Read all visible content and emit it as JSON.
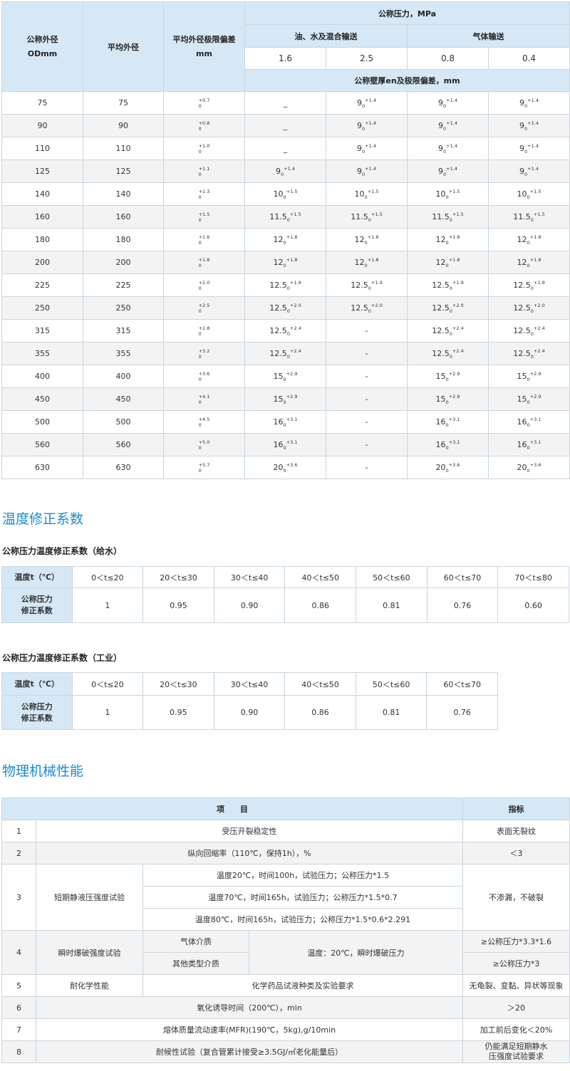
{
  "pipe_table": {
    "headers": {
      "od": "公称外径",
      "od_unit": "ODmm",
      "mean_od": "平均外径",
      "tol": "平均外径极限偏差",
      "tol_unit": "mm",
      "pressure": "公称压力，MPa",
      "oil_water": "油、水及混合输送",
      "gas": "气体输送",
      "p1": "1.6",
      "p2": "2.5",
      "p3": "0.8",
      "p4": "0.4",
      "wall": "公称壁厚en及极限偏差，mm"
    },
    "rows": [
      {
        "od": "75",
        "mean": "75",
        "tol": "+0.7",
        "c1": {
          "v": "_",
          "t": ""
        },
        "c2": {
          "v": "9",
          "t": "+1.4"
        },
        "c3": {
          "v": "9",
          "t": "+1.4"
        },
        "c4": {
          "v": "9",
          "t": "+1.4"
        }
      },
      {
        "od": "90",
        "mean": "90",
        "tol": "+0.8",
        "c1": {
          "v": "_",
          "t": ""
        },
        "c2": {
          "v": "9",
          "t": "+1.4"
        },
        "c3": {
          "v": "9",
          "t": "+1.4"
        },
        "c4": {
          "v": "9",
          "t": "+1.4"
        }
      },
      {
        "od": "110",
        "mean": "110",
        "tol": "+1.0",
        "c1": {
          "v": "_",
          "t": ""
        },
        "c2": {
          "v": "9",
          "t": "+1.4"
        },
        "c3": {
          "v": "9",
          "t": "+1.4"
        },
        "c4": {
          "v": "9",
          "t": "+1.4"
        }
      },
      {
        "od": "125",
        "mean": "125",
        "tol": "+1.1",
        "c1": {
          "v": "9",
          "t": "+1.4"
        },
        "c2": {
          "v": "9",
          "t": "+1.4"
        },
        "c3": {
          "v": "9",
          "t": "+1.4"
        },
        "c4": {
          "v": "9",
          "t": "+1.4"
        }
      },
      {
        "od": "140",
        "mean": "140",
        "tol": "+1.3",
        "c1": {
          "v": "10",
          "t": "+1.5"
        },
        "c2": {
          "v": "10",
          "t": "+1.5"
        },
        "c3": {
          "v": "10",
          "t": "+1.5"
        },
        "c4": {
          "v": "10",
          "t": "+1.5"
        }
      },
      {
        "od": "160",
        "mean": "160",
        "tol": "+1.5",
        "c1": {
          "v": "11.5",
          "t": "+1.5"
        },
        "c2": {
          "v": "11.5",
          "t": "+1.5"
        },
        "c3": {
          "v": "11.5",
          "t": "+1.5"
        },
        "c4": {
          "v": "11.5",
          "t": "+1.5"
        }
      },
      {
        "od": "180",
        "mean": "180",
        "tol": "+1.6",
        "c1": {
          "v": "12",
          "t": "+1.8"
        },
        "c2": {
          "v": "12",
          "t": "+1.8"
        },
        "c3": {
          "v": "12",
          "t": "+1.8"
        },
        "c4": {
          "v": "12",
          "t": "+1.8"
        }
      },
      {
        "od": "200",
        "mean": "200",
        "tol": "+1.8",
        "c1": {
          "v": "12",
          "t": "+1.8"
        },
        "c2": {
          "v": "12",
          "t": "+1.8"
        },
        "c3": {
          "v": "12",
          "t": "+1.8"
        },
        "c4": {
          "v": "12",
          "t": "+1.8"
        }
      },
      {
        "od": "225",
        "mean": "225",
        "tol": "+2.0",
        "c1": {
          "v": "12.5",
          "t": "+1.9"
        },
        "c2": {
          "v": "12.5",
          "t": "+1.9"
        },
        "c3": {
          "v": "12.5",
          "t": "+1.9"
        },
        "c4": {
          "v": "12.5",
          "t": "+1.9"
        }
      },
      {
        "od": "250",
        "mean": "250",
        "tol": "+2.5",
        "c1": {
          "v": "12.5",
          "t": "+2.0"
        },
        "c2": {
          "v": "12.5",
          "t": "+2.0"
        },
        "c3": {
          "v": "12.5",
          "t": "+2.0"
        },
        "c4": {
          "v": "12.5",
          "t": "+2.0"
        }
      },
      {
        "od": "315",
        "mean": "315",
        "tol": "+2.8",
        "c1": {
          "v": "12.5",
          "t": "+2.4"
        },
        "c2": {
          "v": "-",
          "t": ""
        },
        "c3": {
          "v": "12.5",
          "t": "+2.4"
        },
        "c4": {
          "v": "12.5",
          "t": "+2.4"
        }
      },
      {
        "od": "355",
        "mean": "355",
        "tol": "+3.2",
        "c1": {
          "v": "12.5",
          "t": "+2.4"
        },
        "c2": {
          "v": "-",
          "t": ""
        },
        "c3": {
          "v": "12.5",
          "t": "+2.4"
        },
        "c4": {
          "v": "12.5",
          "t": "+2.4"
        }
      },
      {
        "od": "400",
        "mean": "400",
        "tol": "+3.6",
        "c1": {
          "v": "15",
          "t": "+2.9"
        },
        "c2": {
          "v": "-",
          "t": ""
        },
        "c3": {
          "v": "15",
          "t": "+2.9"
        },
        "c4": {
          "v": "15",
          "t": "+2.9"
        }
      },
      {
        "od": "450",
        "mean": "450",
        "tol": "+4.1",
        "c1": {
          "v": "15",
          "t": "+2.9"
        },
        "c2": {
          "v": "-",
          "t": ""
        },
        "c3": {
          "v": "15",
          "t": "+2.9"
        },
        "c4": {
          "v": "15",
          "t": "+2.9"
        }
      },
      {
        "od": "500",
        "mean": "500",
        "tol": "+4.5",
        "c1": {
          "v": "16",
          "t": "+3.1"
        },
        "c2": {
          "v": "-",
          "t": ""
        },
        "c3": {
          "v": "16",
          "t": "+3.1"
        },
        "c4": {
          "v": "16",
          "t": "+3.1"
        }
      },
      {
        "od": "560",
        "mean": "560",
        "tol": "+5.0",
        "c1": {
          "v": "16",
          "t": "+3.1"
        },
        "c2": {
          "v": "-",
          "t": ""
        },
        "c3": {
          "v": "16",
          "t": "+3.1"
        },
        "c4": {
          "v": "16",
          "t": "+3.1"
        }
      },
      {
        "od": "630",
        "mean": "630",
        "tol": "+5.7",
        "c1": {
          "v": "20",
          "t": "+3.6"
        },
        "c2": {
          "v": "-",
          "t": ""
        },
        "c3": {
          "v": "20",
          "t": "+3.6"
        },
        "c4": {
          "v": "20",
          "t": "+3.6"
        }
      }
    ],
    "zero": "0"
  },
  "temp_section": {
    "title": "温度修正系数",
    "water": {
      "subtitle": "公称压力温度修正系数（给水）",
      "row1_label": "温度t（℃）",
      "row2_label_l1": "公称压力",
      "row2_label_l2": "修正系数",
      "ranges": [
        "0＜t≤20",
        "20＜t≤30",
        "30＜t≤40",
        "40＜t≤50",
        "50＜t≤60",
        "60＜t≤70",
        "70＜t≤80"
      ],
      "factors": [
        "1",
        "0.95",
        "0.90",
        "0.86",
        "0.81",
        "0.76",
        "0.60"
      ]
    },
    "industry": {
      "subtitle": "公称压力温度修正系数（工业）",
      "row1_label": "温度t（℃）",
      "row2_label_l1": "公称压力",
      "row2_label_l2": "修正系数",
      "ranges": [
        "0＜t≤20",
        "20＜t≤30",
        "30＜t≤40",
        "40＜t≤50",
        "50＜t≤60",
        "60＜t≤70"
      ],
      "factors": [
        "1",
        "0.95",
        "0.90",
        "0.86",
        "0.81",
        "0.76"
      ]
    }
  },
  "phys_section": {
    "title": "物理机械性能",
    "head_item": "项　　目",
    "head_index": "指标",
    "r1": {
      "no": "1",
      "item": "受压开裂稳定性",
      "index": "表面无裂纹"
    },
    "r2": {
      "no": "2",
      "item": "纵向回缩率（110℃，保持1h），%",
      "index": "＜3"
    },
    "r3": {
      "no": "3",
      "name": "短期静液压强度试验",
      "c1": "温度20℃，时间100h，试验压力；公称压力*1.5",
      "c2": "温度70℃，时间165h，试验压力；公称压力*1.5*0.7",
      "c3": "温度80℃，时间165h，试验压力；公称压力*1.5*0.6*2.291",
      "index": "不渗漏，不破裂"
    },
    "r4": {
      "no": "4",
      "name": "瞬时爆破强度试验",
      "m1": "气体介质",
      "m2": "其他类型介质",
      "cond": "温度：20℃，瞬时爆破压力",
      "i1": "≥公称压力*3.3*1.6",
      "i2": "≥公称压力*3"
    },
    "r5": {
      "no": "5",
      "name": "耐化学性能",
      "item": "化学药品试液种类及实验要求",
      "index": "无龟裂、变黏、异状等现象"
    },
    "r6": {
      "no": "6",
      "item": "氧化诱导时间（200℃），min",
      "index": "＞20"
    },
    "r7": {
      "no": "7",
      "item": "熔体质量流动速率(MFR)(190℃，5kg),g/10min",
      "index": "加工前后变化＜20%"
    },
    "r8": {
      "no": "8",
      "item": "耐候性试验（复合管累计接受≥3.5GJ/㎡老化能量后）",
      "index_l1": "仍能满足短期静水",
      "index_l2": "压强度试验要求"
    }
  }
}
